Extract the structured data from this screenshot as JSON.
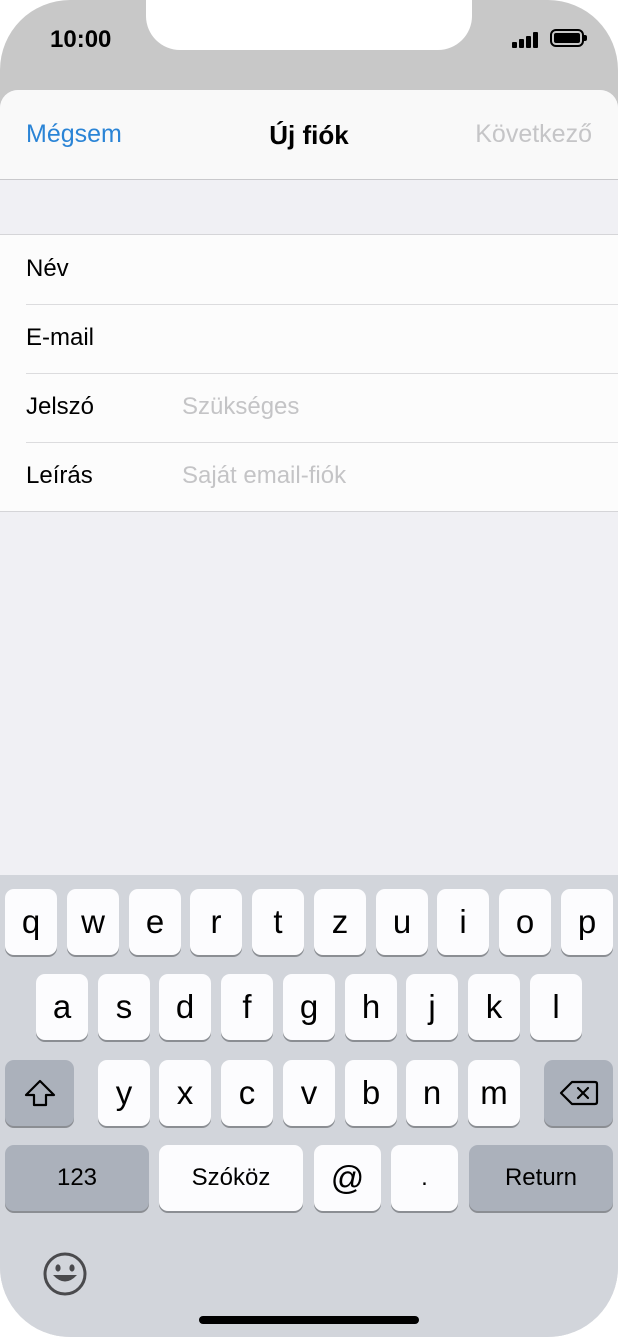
{
  "status": {
    "time": "10:00"
  },
  "nav": {
    "cancel": "Mégsem",
    "title": "Új fiók",
    "next": "Következő"
  },
  "form": {
    "rows": [
      {
        "label": "Név",
        "value": "",
        "placeholder": ""
      },
      {
        "label": "E-mail",
        "value": "",
        "placeholder": ""
      },
      {
        "label": "Jelszó",
        "value": "",
        "placeholder": "Szükséges"
      },
      {
        "label": "Leírás",
        "value": "",
        "placeholder": "Saját email-fiók"
      }
    ]
  },
  "keyboard": {
    "row1": [
      "q",
      "w",
      "e",
      "r",
      "t",
      "z",
      "u",
      "i",
      "o",
      "p"
    ],
    "row2": [
      "a",
      "s",
      "d",
      "f",
      "g",
      "h",
      "j",
      "k",
      "l"
    ],
    "row3": [
      "y",
      "x",
      "c",
      "v",
      "b",
      "n",
      "m"
    ],
    "numbers": "123",
    "space": "Szóköz",
    "at": "@",
    "dot": ".",
    "return": "Return"
  },
  "colors": {
    "accent": "#2a84d6",
    "disabled": "#c5c5c7"
  }
}
